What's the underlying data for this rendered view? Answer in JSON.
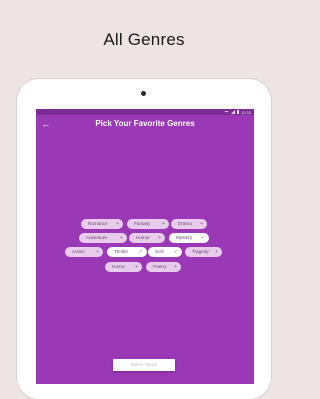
{
  "headline": "All Genres",
  "statusbar": {
    "time": "12:33"
  },
  "toolbar": {
    "back_icon": "arrow-left-icon",
    "title": "Pick Your Favorite Genres"
  },
  "genres": [
    {
      "label": "Romance",
      "selected": false,
      "indicator": "plus"
    },
    {
      "label": "Fantasy",
      "selected": false,
      "indicator": "plus"
    },
    {
      "label": "Drama",
      "selected": false,
      "indicator": "plus"
    },
    {
      "label": "Adventure",
      "selected": false,
      "indicator": "plus"
    },
    {
      "label": "Humor",
      "selected": false,
      "indicator": "plus"
    },
    {
      "label": "Mystery",
      "selected": true,
      "indicator": "check"
    },
    {
      "label": "Action",
      "selected": false,
      "indicator": "plus"
    },
    {
      "label": "Thriller",
      "selected": true,
      "indicator": "check"
    },
    {
      "label": "Scifi",
      "selected": true,
      "indicator": "check"
    },
    {
      "label": "Tragedy",
      "selected": false,
      "indicator": "plus"
    },
    {
      "label": "Horror",
      "selected": false,
      "indicator": "plus"
    },
    {
      "label": "Poetry",
      "selected": false,
      "indicator": "plus"
    }
  ],
  "select_button": {
    "label": "Select Topics"
  },
  "colors": {
    "screen": "#9b38b5",
    "chip": "#e7cdeb",
    "chip_selected": "#ffffff",
    "background": "#ede4e3"
  }
}
